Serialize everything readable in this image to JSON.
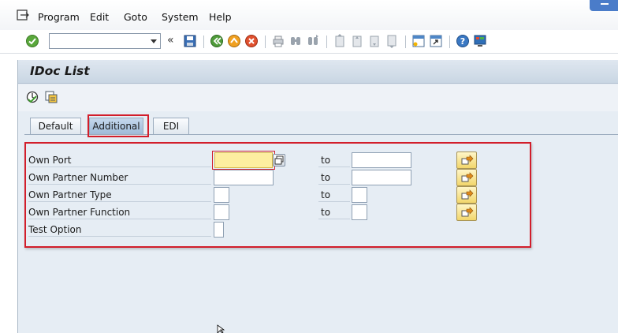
{
  "menubar": {
    "items": [
      {
        "label": "Program"
      },
      {
        "label": "Edit"
      },
      {
        "label": "Goto"
      },
      {
        "label": "System"
      },
      {
        "label": "Help"
      }
    ]
  },
  "toolbar": {
    "command_field_value": "",
    "buttons": [
      "enter-icon",
      "save-icon",
      "back-icon",
      "exit-icon",
      "cancel-icon",
      "print-icon",
      "find-icon",
      "find-next-icon",
      "first-page-icon",
      "previous-page-icon",
      "next-page-icon",
      "last-page-icon",
      "create-session-icon",
      "shortcut-icon",
      "help-icon",
      "customize-layout-icon"
    ]
  },
  "screen": {
    "title": "IDoc List",
    "app_toolbar": [
      "execute-icon",
      "get-variant-icon"
    ],
    "tabs": [
      {
        "label": "Default",
        "active": false
      },
      {
        "label": "Additional",
        "active": true
      },
      {
        "label": "EDI",
        "active": false
      }
    ]
  },
  "form": {
    "to_label": "to",
    "rows": [
      {
        "label": "Own Port",
        "from": "",
        "to": "",
        "has_range": true
      },
      {
        "label": "Own Partner Number",
        "from": "",
        "to": "",
        "has_range": true
      },
      {
        "label": "Own Partner Type",
        "from": "",
        "to": "",
        "has_range": true
      },
      {
        "label": "Own Partner Function",
        "from": "",
        "to": "",
        "has_range": true
      },
      {
        "label": "Test Option",
        "from": "",
        "has_range": false
      }
    ]
  },
  "colors": {
    "highlight": "#d21e2b",
    "focus_field": "#fdeea0",
    "screen_bg": "#e6edf4"
  }
}
